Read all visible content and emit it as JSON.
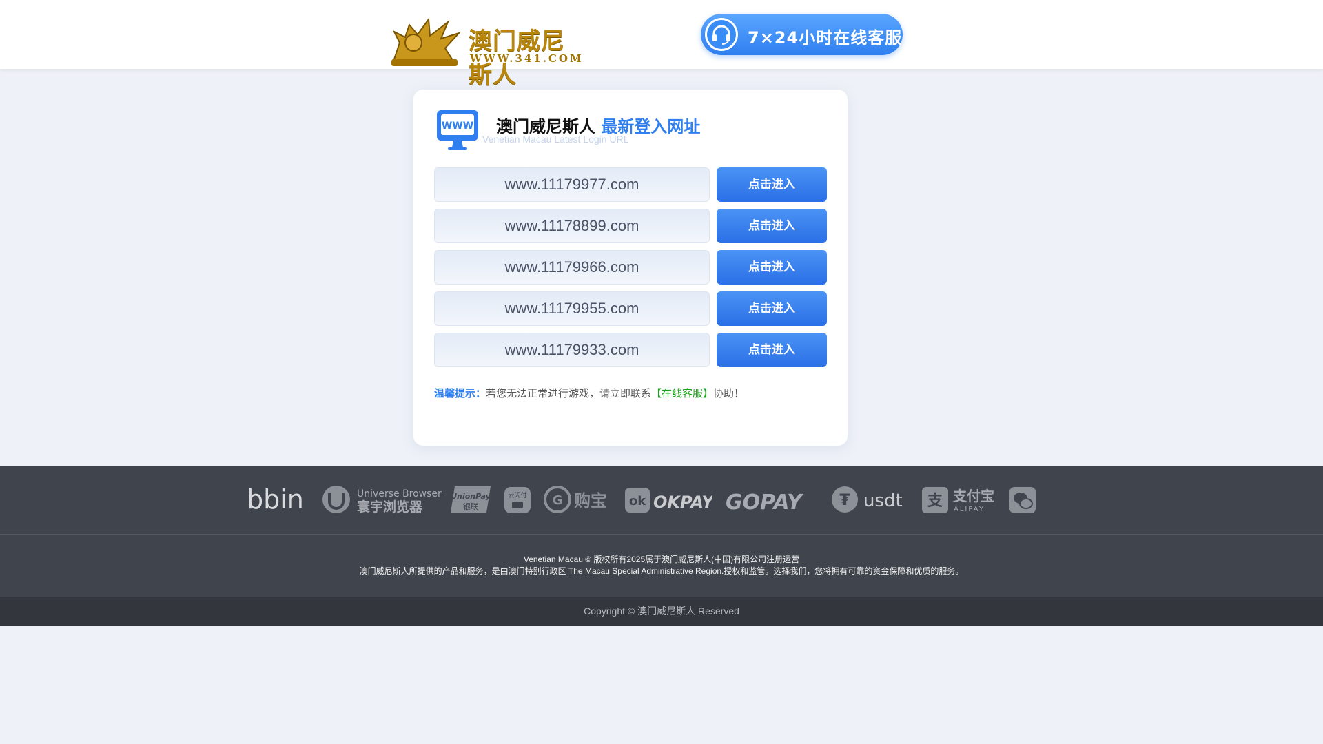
{
  "header": {
    "logo_text": "澳门威尼斯人",
    "logo_sub": "WWW.341.COM",
    "service_label": "7×24小时在线客服"
  },
  "card": {
    "title_main": "澳门威尼斯人",
    "title_accent": "最新登入网址",
    "subtitle": "Venetian Macau Latest Login URL",
    "rows": [
      {
        "url": "www.11179977.com",
        "button": "点击进入"
      },
      {
        "url": "www.11178899.com",
        "button": "点击进入"
      },
      {
        "url": "www.11179966.com",
        "button": "点击进入"
      },
      {
        "url": "www.11179955.com",
        "button": "点击进入"
      },
      {
        "url": "www.11179933.com",
        "button": "点击进入"
      }
    ],
    "tip_label": "温馨提示：",
    "tip_text": "若您无法正常进行游戏，请立即联系",
    "tip_link": "【在线客服】",
    "tip_end": "协助！"
  },
  "partners": {
    "bbin": "bbin",
    "universe_en": "Universe Browser",
    "universe_cn": "寰宇浏览器",
    "unionpay": "UnionPay",
    "unionpay_cn": "银联",
    "cloudpay": "云闪付",
    "goubao": "购宝",
    "okpay": "OKPAY",
    "gopay": "GOPAY",
    "usdt": "usdt",
    "alipay_cn": "支付宝",
    "alipay_en": "ALIPAY"
  },
  "footer": {
    "line1": "Venetian Macau © 版权所有2025属于澳门威尼斯人(中国)有限公司注册运营",
    "line2": "澳门威尼斯人所提供的产品和服务，是由澳门特别行政区 The Macau Special Administrative Region.授权和监管。选择我们，您将拥有可靠的资金保障和优质的服务。",
    "copyright": "Copyright © 澳门威尼斯人 Reserved"
  },
  "colors": {
    "accent": "#2f7ff0",
    "gold": "#b8860b",
    "link_green": "#1aa31a",
    "footer_bg": "#40454d"
  }
}
